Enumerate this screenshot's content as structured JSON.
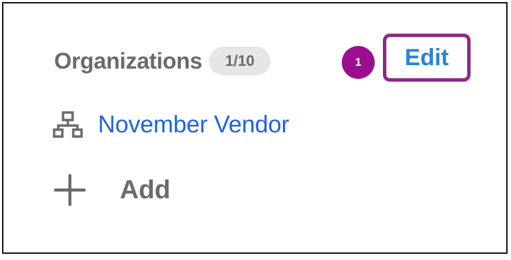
{
  "organizations": {
    "title": "Organizations",
    "count_badge": "1/10",
    "edit_label": "Edit",
    "items": [
      {
        "label": "November Vendor",
        "icon": "sitemap-icon"
      }
    ],
    "add_label": "Add",
    "add_icon": "plus-icon"
  },
  "callout": {
    "step_number": "1",
    "color": "#9a0f8e",
    "highlight_color": "#8e2a86"
  },
  "colors": {
    "link": "#1f63e0",
    "edit_link": "#2a84d6",
    "muted_text": "#6b6b6b",
    "badge_bg": "#e6e6e6"
  }
}
